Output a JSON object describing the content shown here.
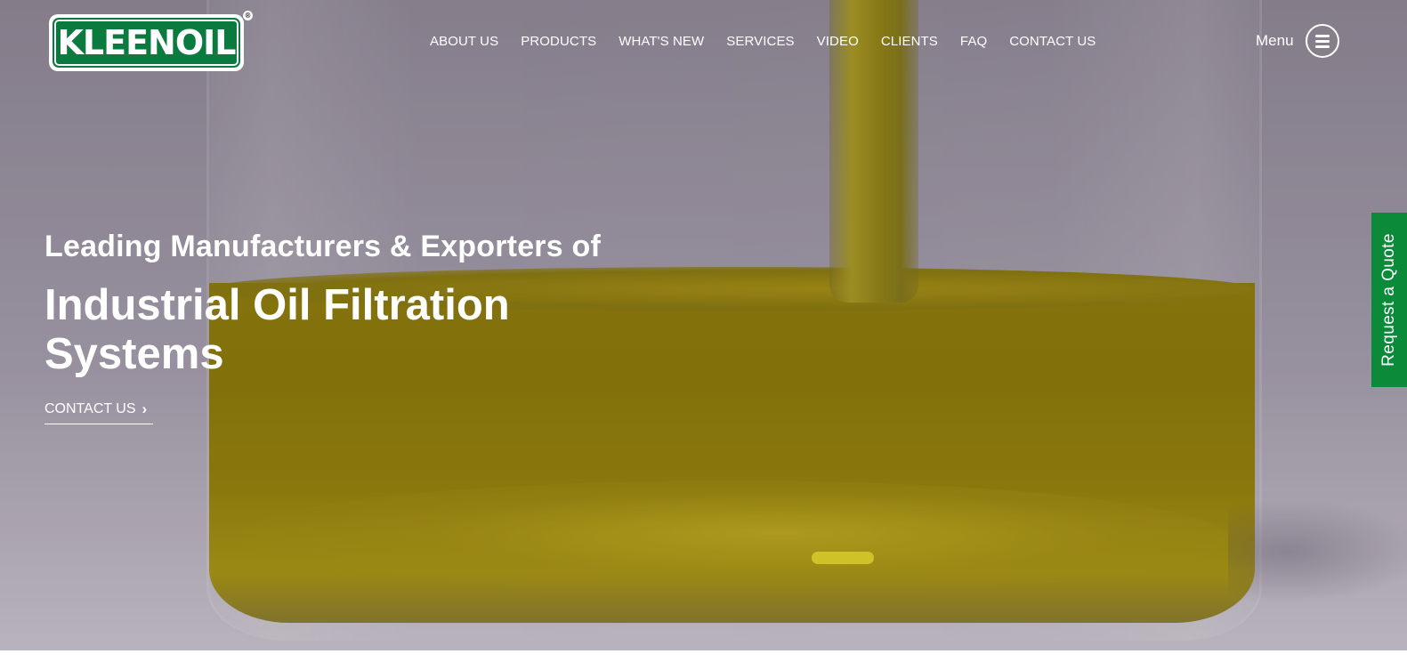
{
  "brand": {
    "logo_text": "KLEENOIL",
    "registered_mark": "®",
    "color": "#0b7a3e"
  },
  "nav": {
    "items": [
      {
        "label": "ABOUT US"
      },
      {
        "label": "PRODUCTS"
      },
      {
        "label": "WHAT'S NEW"
      },
      {
        "label": "SERVICES"
      },
      {
        "label": "VIDEO"
      },
      {
        "label": "CLIENTS"
      },
      {
        "label": "FAQ"
      },
      {
        "label": "CONTACT US"
      }
    ],
    "menu_label": "Menu",
    "menu_icon": "hamburger-circle-icon"
  },
  "hero": {
    "subtitle": "Leading Manufacturers & Exporters of",
    "title": "Industrial Oil Filtration Systems",
    "cta_label": "CONTACT US",
    "cta_icon": "chevron-right-icon"
  },
  "quote_tab": {
    "label": "Request a Quote",
    "color": "#0b8a3a"
  }
}
